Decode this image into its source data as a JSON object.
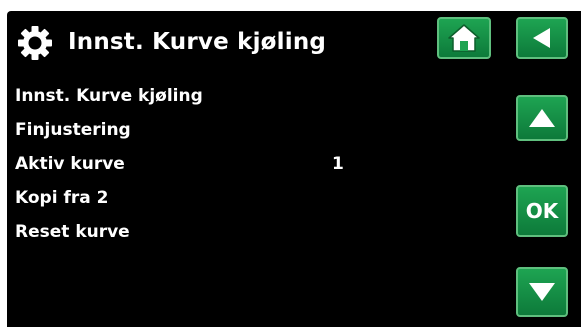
{
  "header": {
    "icon": "gear-icon",
    "title": "Innst. Kurve kjøling"
  },
  "nav": {
    "home_icon": "home-icon",
    "back_icon": "back-arrow-icon",
    "up_icon": "up-arrow-icon",
    "ok_label": "OK",
    "down_icon": "down-arrow-icon"
  },
  "menu": {
    "items": [
      {
        "label": "Innst. Kurve kjøling",
        "value": ""
      },
      {
        "label": "Finjustering",
        "value": ""
      },
      {
        "label": "Aktiv kurve",
        "value": "1"
      },
      {
        "label": "Kopi fra 2",
        "value": ""
      },
      {
        "label": "Reset kurve",
        "value": ""
      }
    ]
  },
  "colors": {
    "background": "#000000",
    "button_green": "#1ea452",
    "button_border": "#5fbf7e",
    "text": "#ffffff"
  }
}
